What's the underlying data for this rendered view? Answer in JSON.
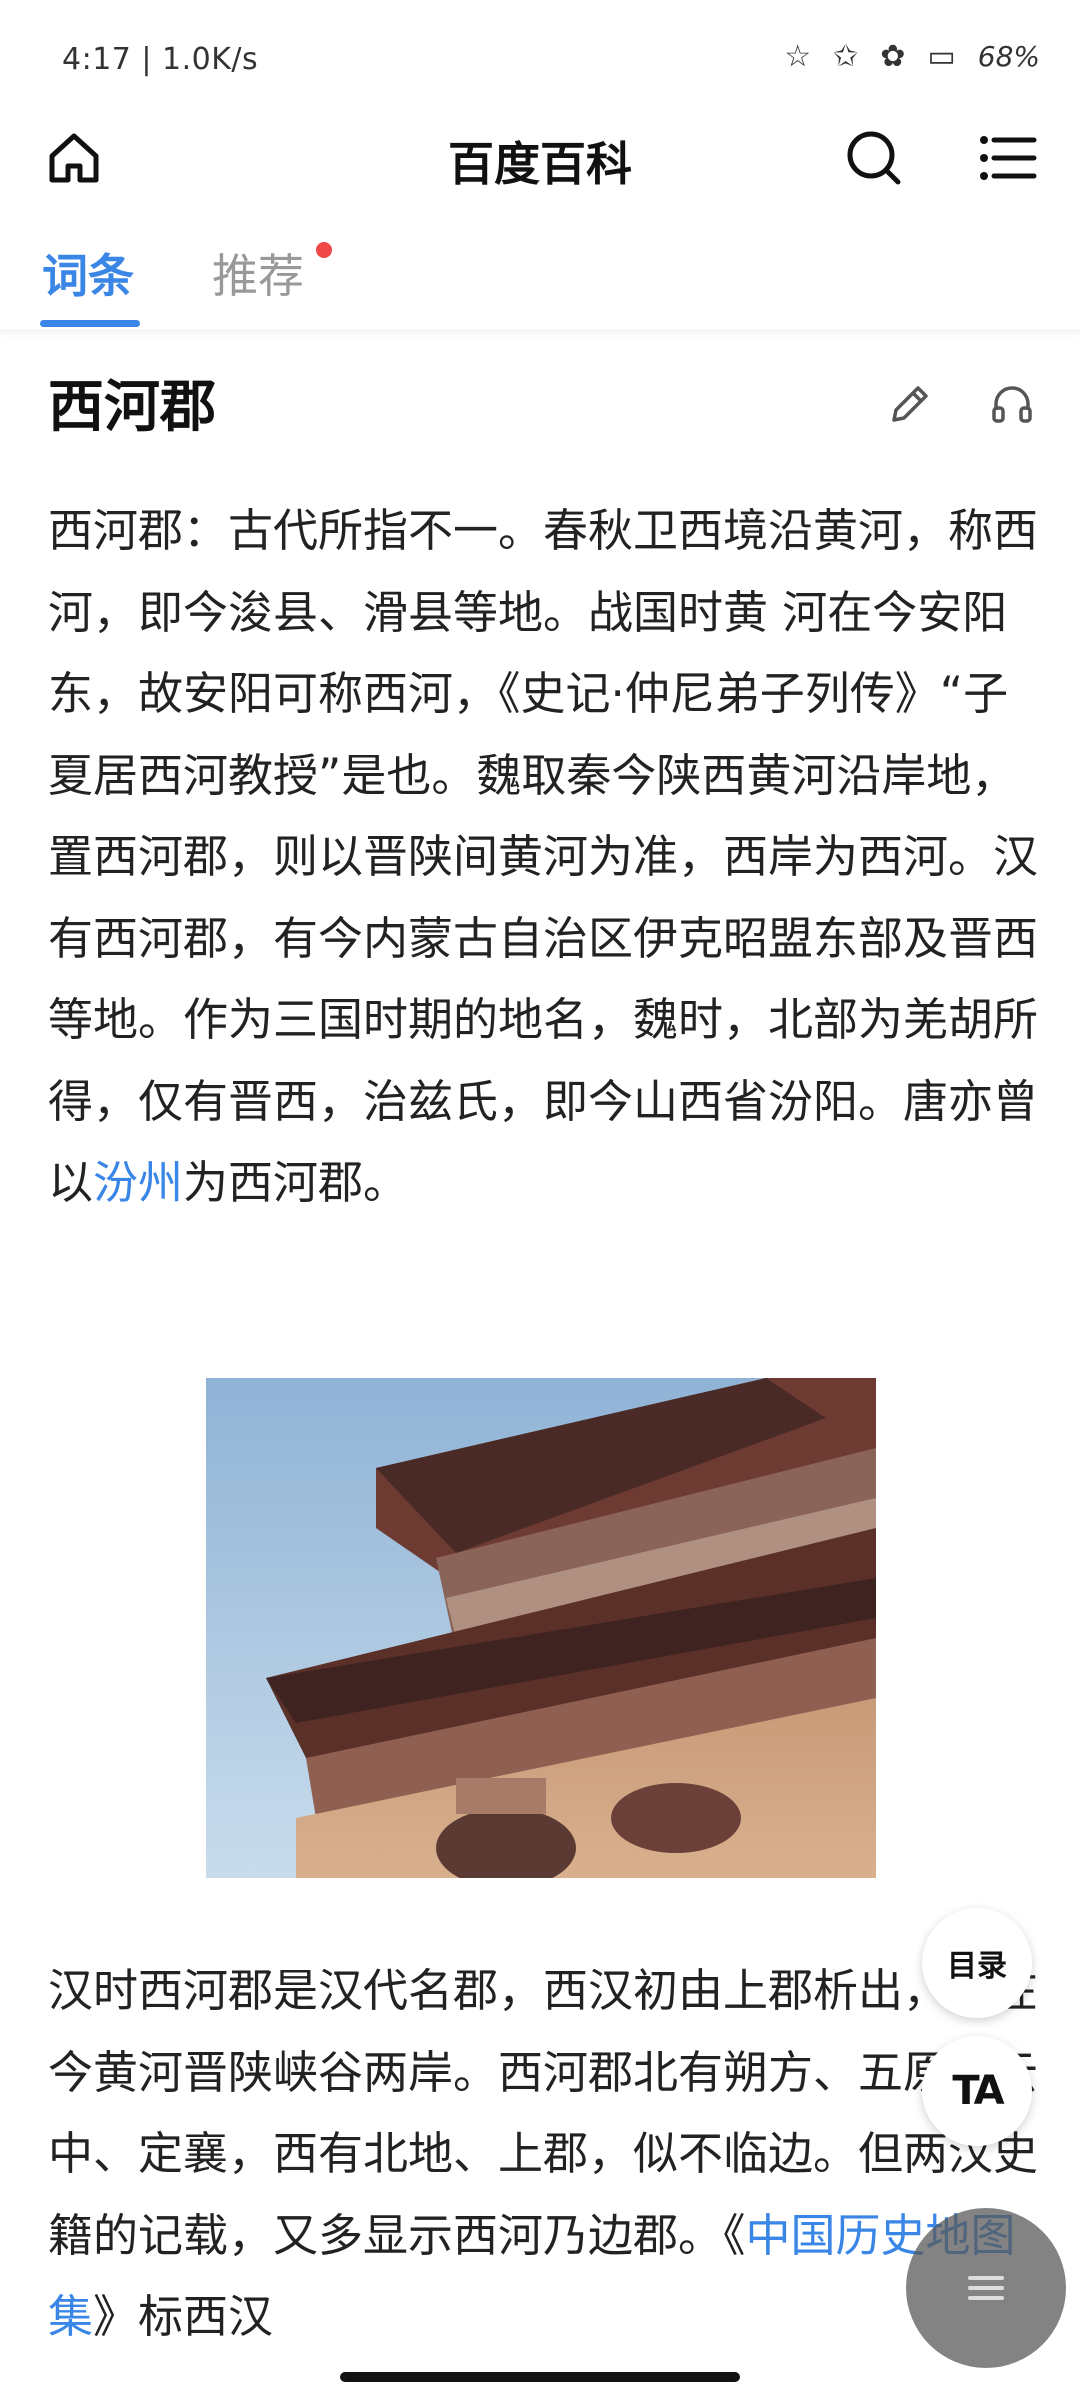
{
  "status_bar": {
    "time": "4:17 | 1.0K/s",
    "battery": "68%"
  },
  "header": {
    "title": "百度百科",
    "home_icon": "home-icon",
    "search_icon": "search-icon",
    "menu_icon": "menu-icon"
  },
  "tabs": [
    {
      "label": "词条",
      "active": true
    },
    {
      "label": "推荐",
      "active": false,
      "badge": true
    }
  ],
  "entry": {
    "title": "西河郡",
    "para1_before_link": "西河郡：古代所指不一。春秋卫西境沿黄河，称西河，即今浚县、滑县等地。战国时黄 河在今安阳东，故安阳可称西河，《史记·仲尼弟子列传》“子夏居西河教授”是也。魏取秦今陕西黄河沿岸地，置西河郡，则以晋陕间黄河为准，西岸为西河。汉有西河郡，有今内蒙古自治区伊克昭盟东部及晋西等地。作为三国时期的地名，魏时，北部为羌胡所得，仅有晋西，治兹氏，即今山西省汾阳。唐亦曾以",
    "para1_link": "汾州",
    "para1_after_link": "为西河郡。",
    "para2_before_link": "汉时西河郡是汉代名郡，西汉初由上郡析出，地在今黄河晋陕峡谷两岸。西河郡北有朔方、五原、云中、定襄，西有北地、上郡，似不临边。但两汉史籍的记载，又多显示西河乃边郡。《",
    "para2_link": "中国历史地图集",
    "para2_after_link": "》标西汉"
  },
  "floating": {
    "toc_label": "目录",
    "font_label": "TA"
  },
  "colors": {
    "accent": "#3a86e6",
    "badge": "#f04848"
  }
}
